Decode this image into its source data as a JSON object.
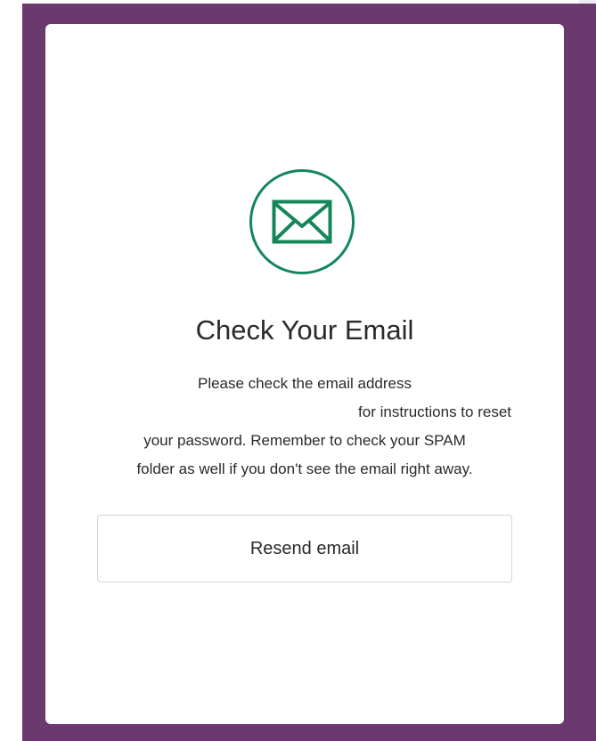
{
  "modal": {
    "title": "Check Your Email",
    "message_lines": [
      "Please check the email address",
      "for instructions to reset",
      "your password. Remember to check your SPAM",
      "folder as well if you don't see the email right away."
    ],
    "resend_label": "Resend email",
    "icon": "envelope-icon"
  },
  "colors": {
    "frame": "#6a3a6f",
    "accent": "#13865a",
    "card": "#ffffff",
    "text": "#2a2a2a"
  }
}
